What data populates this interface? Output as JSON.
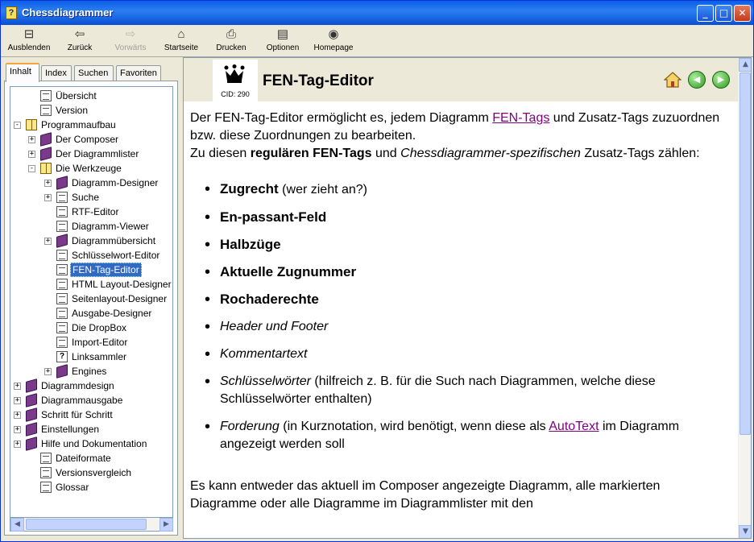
{
  "window": {
    "title": "Chessdiagrammer",
    "controls": {
      "minimize": "_",
      "maximize": "□",
      "close": "✕"
    }
  },
  "toolbar": {
    "items": [
      {
        "label": "Ausblenden",
        "icon": "hide-panel-icon",
        "glyph": "⊟",
        "disabled": false
      },
      {
        "label": "Zurück",
        "icon": "back-arrow-icon",
        "glyph": "⇦",
        "disabled": false
      },
      {
        "label": "Vorwärts",
        "icon": "forward-arrow-icon",
        "glyph": "⇨",
        "disabled": true
      },
      {
        "label": "Startseite",
        "icon": "home-icon",
        "glyph": "⌂",
        "disabled": false
      },
      {
        "label": "Drucken",
        "icon": "printer-icon",
        "glyph": "⎙",
        "disabled": false
      },
      {
        "label": "Optionen",
        "icon": "options-icon",
        "glyph": "▤",
        "disabled": false
      },
      {
        "label": "Homepage",
        "icon": "homepage-icon",
        "glyph": "◉",
        "disabled": false
      }
    ]
  },
  "sidebar": {
    "tabs": [
      "Inhalt",
      "Index",
      "Suchen",
      "Favoriten"
    ],
    "active_tab": "Inhalt",
    "tree": [
      {
        "label": "Übersicht",
        "level": 1,
        "icon": "page",
        "expander": ""
      },
      {
        "label": "Version",
        "level": 1,
        "icon": "page",
        "expander": ""
      },
      {
        "label": "Programmaufbau",
        "level": 0,
        "icon": "open",
        "expander": "-"
      },
      {
        "label": "Der Composer",
        "level": 1,
        "icon": "book",
        "expander": "+"
      },
      {
        "label": "Der Diagrammlister",
        "level": 1,
        "icon": "book",
        "expander": "+"
      },
      {
        "label": "Die Werkzeuge",
        "level": 1,
        "icon": "open",
        "expander": "-"
      },
      {
        "label": "Diagramm-Designer",
        "level": 2,
        "icon": "book",
        "expander": "+"
      },
      {
        "label": "Suche",
        "level": 2,
        "icon": "page",
        "expander": "+"
      },
      {
        "label": "RTF-Editor",
        "level": 2,
        "icon": "page",
        "expander": ""
      },
      {
        "label": "Diagramm-Viewer",
        "level": 2,
        "icon": "page",
        "expander": ""
      },
      {
        "label": "Diagrammübersicht",
        "level": 2,
        "icon": "book",
        "expander": "+"
      },
      {
        "label": "Schlüsselwort-Editor",
        "level": 2,
        "icon": "page",
        "expander": ""
      },
      {
        "label": "FEN-Tag-Editor",
        "level": 2,
        "icon": "page",
        "expander": "",
        "selected": true
      },
      {
        "label": "HTML Layout-Designer",
        "level": 2,
        "icon": "page",
        "expander": ""
      },
      {
        "label": "Seitenlayout-Designer",
        "level": 2,
        "icon": "page",
        "expander": ""
      },
      {
        "label": "Ausgabe-Designer",
        "level": 2,
        "icon": "page",
        "expander": ""
      },
      {
        "label": "Die DropBox",
        "level": 2,
        "icon": "page",
        "expander": ""
      },
      {
        "label": "Import-Editor",
        "level": 2,
        "icon": "page",
        "expander": ""
      },
      {
        "label": "Linksammler",
        "level": 2,
        "icon": "help",
        "expander": ""
      },
      {
        "label": "Engines",
        "level": 2,
        "icon": "book",
        "expander": "+"
      },
      {
        "label": "Diagrammdesign",
        "level": 0,
        "icon": "book",
        "expander": "+"
      },
      {
        "label": "Diagrammausgabe",
        "level": 0,
        "icon": "book",
        "expander": "+"
      },
      {
        "label": "Schritt für Schritt",
        "level": 0,
        "icon": "book",
        "expander": "+"
      },
      {
        "label": "Einstellungen",
        "level": 0,
        "icon": "book",
        "expander": "+"
      },
      {
        "label": "Hilfe und Dokumentation",
        "level": 0,
        "icon": "book",
        "expander": "+"
      },
      {
        "label": "Dateiformate",
        "level": 1,
        "icon": "page",
        "expander": ""
      },
      {
        "label": "Versionsvergleich",
        "level": 1,
        "icon": "page",
        "expander": ""
      },
      {
        "label": "Glossar",
        "level": 1,
        "icon": "page",
        "expander": ""
      }
    ]
  },
  "content": {
    "cid": "CID: 290",
    "title": "FEN-Tag-Editor",
    "intro": {
      "t1": "Der FEN-Tag-Editor ermöglicht es, jedem Diagramm ",
      "link1": "FEN-Tags",
      "t2": " und Zusatz-Tags zuzuordnen bzw. diese Zuordnungen zu bearbeiten.",
      "t3": "Zu diesen ",
      "b1": "regulären FEN-Tags",
      "t4": " und ",
      "i1": "Chessdiagrammer-spezifischen",
      "t5": " Zusatz-Tags zählen:"
    },
    "bullets": {
      "b1": "Zugrecht",
      "b1s": " (wer zieht an?)",
      "b2": "En-passant-Feld",
      "b3": "Halbzüge",
      "b4": "Aktuelle Zugnummer",
      "b5": "Rochaderechte",
      "b6": "Header und Footer",
      "b7": "Kommentartext",
      "b8": "Schlüsselwörter",
      "b8s": " (hilfreich z. B. für die Such nach Diagrammen, welche diese Schlüsselwörter enthalten)",
      "b9": "Forderung",
      "b9s": " (in Kurznotation, wird benötigt, wenn diese als ",
      "b9link": "AutoText",
      "b9e": " im Diagramm angezeigt werden soll"
    },
    "para2": "Es kann entweder das aktuell im Composer angezeigte Diagramm, alle markierten Diagramme oder alle Diagramme im Diagrammlister mit den"
  }
}
